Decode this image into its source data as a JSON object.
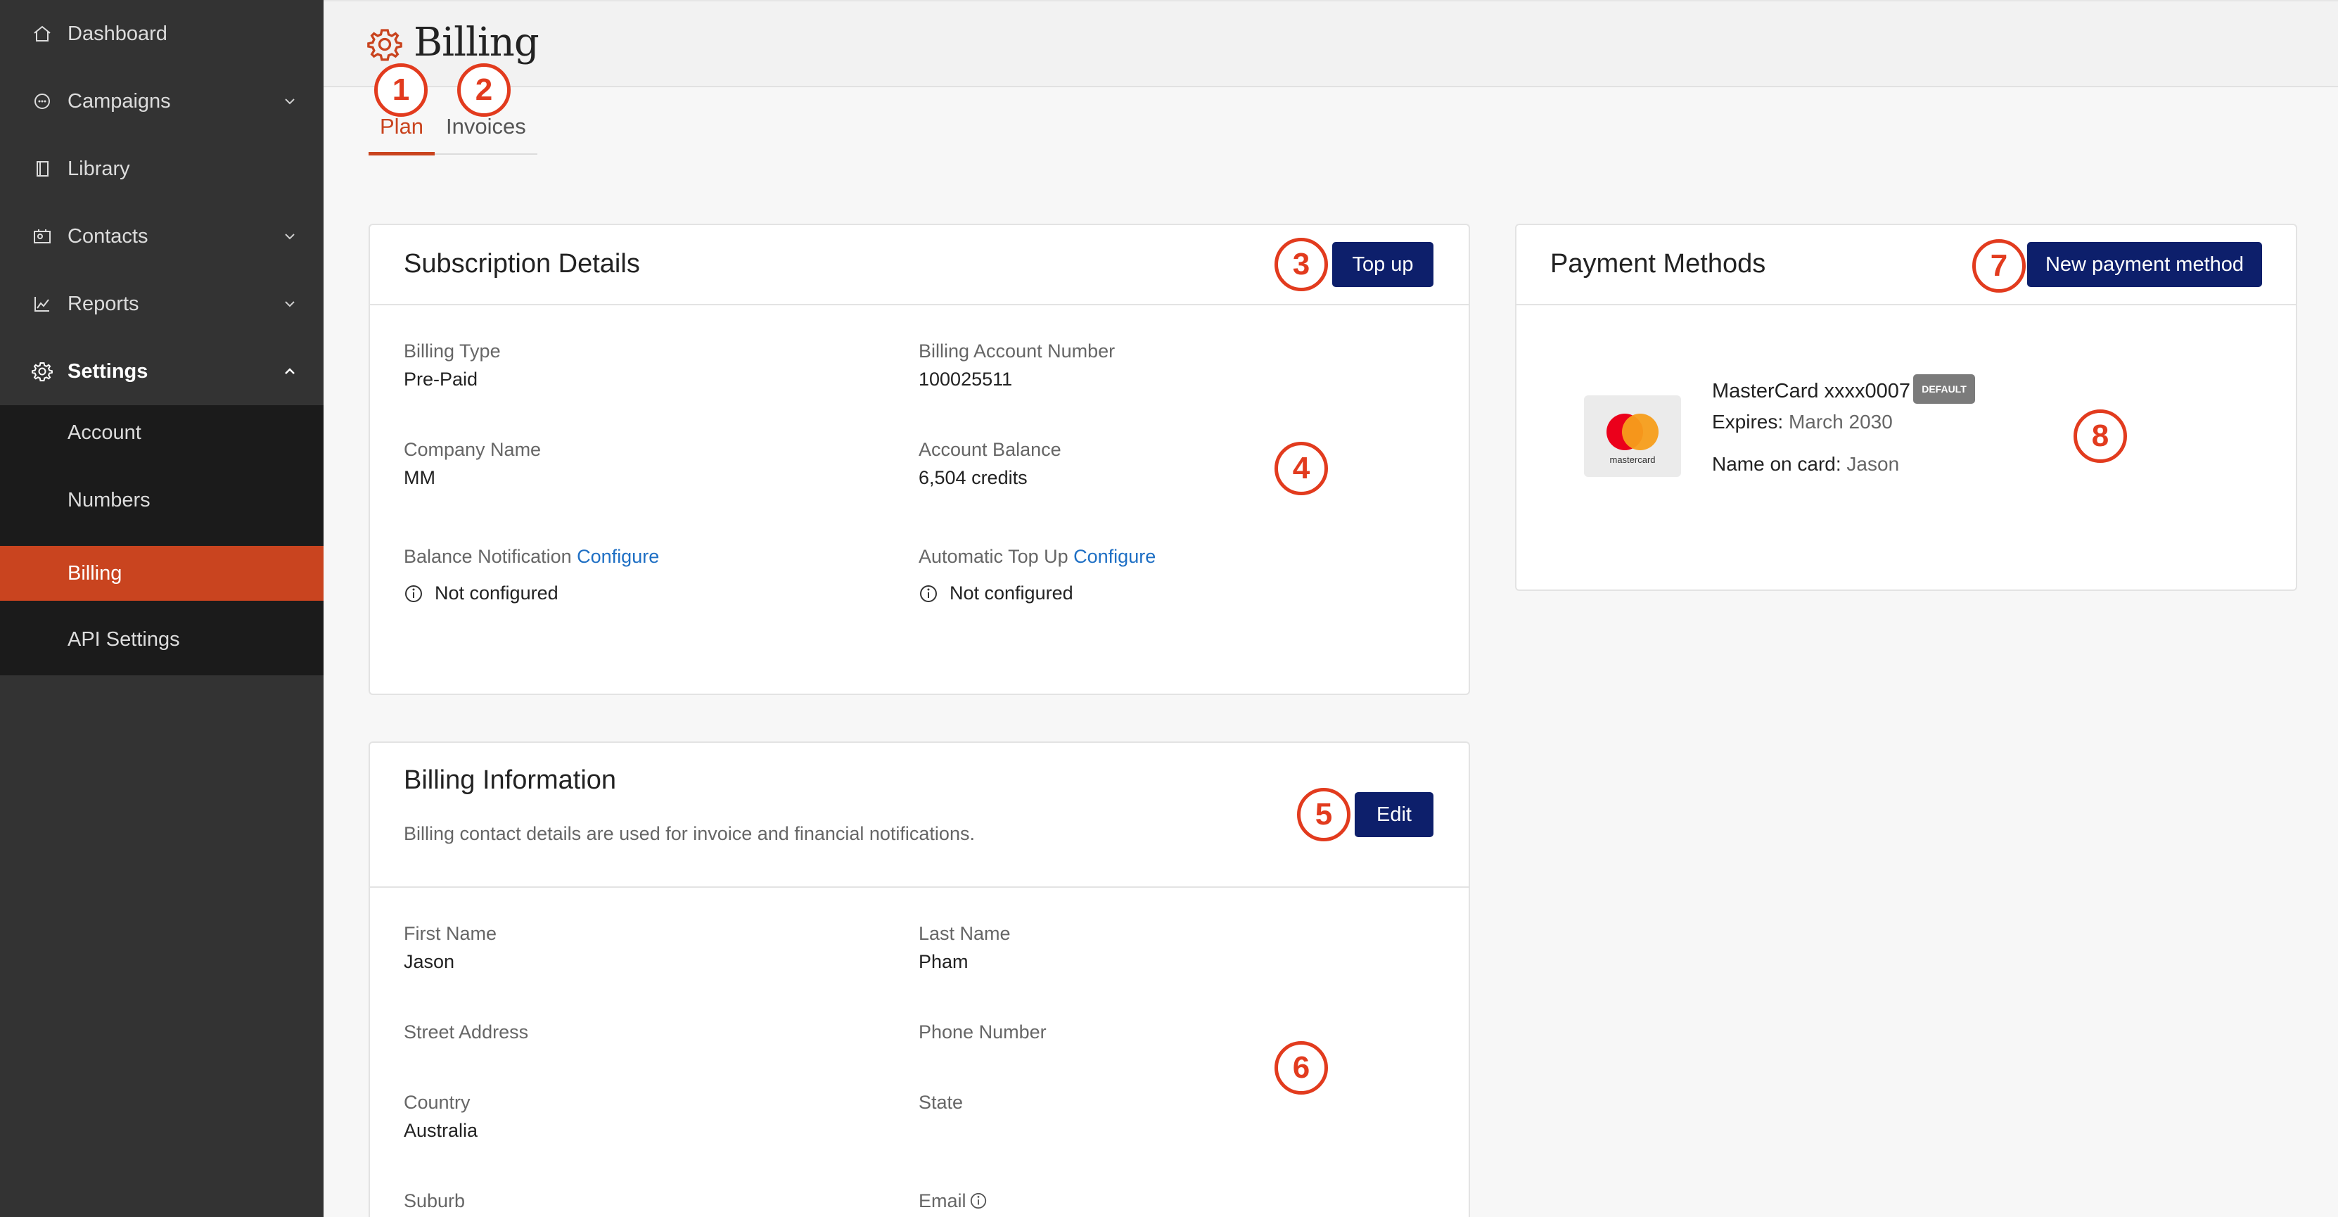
{
  "sidebar": {
    "items": [
      {
        "label": "Dashboard",
        "icon": "home-icon"
      },
      {
        "label": "Campaigns",
        "icon": "chat-bubble-icon"
      },
      {
        "label": "Library",
        "icon": "book-icon"
      },
      {
        "label": "Contacts",
        "icon": "contact-card-icon"
      },
      {
        "label": "Reports",
        "icon": "chart-line-icon"
      },
      {
        "label": "Settings",
        "icon": "gear-icon"
      }
    ],
    "settings_sub": [
      {
        "label": "Account"
      },
      {
        "label": "Numbers"
      },
      {
        "label": "Billing"
      },
      {
        "label": "API Settings"
      }
    ]
  },
  "header": {
    "title": "Billing"
  },
  "tabs": [
    {
      "label": "Plan"
    },
    {
      "label": "Invoices"
    }
  ],
  "subscription": {
    "title": "Subscription Details",
    "topup_label": "Top up",
    "billing_type_label": "Billing Type",
    "billing_type": "Pre-Paid",
    "account_number_label": "Billing Account Number",
    "account_number": "100025511",
    "company_label": "Company Name",
    "company": "MM",
    "balance_label": "Account Balance",
    "balance": "6,504 credits",
    "balance_notif_label": "Balance Notification",
    "configure": "Configure",
    "balance_notif_status": "Not configured",
    "auto_topup_label": "Automatic Top Up",
    "auto_topup_status": "Not configured"
  },
  "billing_info": {
    "title": "Billing Information",
    "description": "Billing contact details are used for invoice and financial notifications.",
    "edit_label": "Edit",
    "first_name_label": "First Name",
    "first_name": "Jason",
    "last_name_label": "Last Name",
    "last_name": "Pham",
    "street_label": "Street Address",
    "phone_label": "Phone Number",
    "country_label": "Country",
    "country": "Australia",
    "state_label": "State",
    "suburb_label": "Suburb",
    "email_label": "Email"
  },
  "payment": {
    "title": "Payment Methods",
    "new_label": "New payment method",
    "card_name": "MasterCard xxxx0007",
    "badge": "DEFAULT",
    "expires_label": "Expires:",
    "expires": "March 2030",
    "name_label": "Name on card:",
    "name": "Jason",
    "brand_text": "mastercard"
  },
  "callouts": [
    "1",
    "2",
    "3",
    "4",
    "5",
    "6",
    "7",
    "8"
  ],
  "colors": {
    "accent": "#c9441f",
    "button": "#0d1f6b",
    "callout": "#e23b1e",
    "link": "#1e6fc4"
  }
}
